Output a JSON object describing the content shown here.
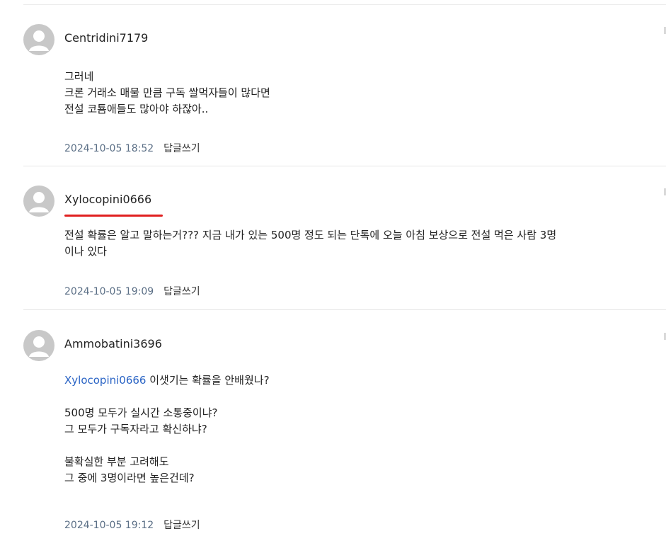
{
  "comments": [
    {
      "author": "Centridini7179",
      "lines": [
        "그러네",
        "크론 거래소 매물 만큼 구독 쌀먹자들이 많다면",
        "전설 코툠애들도 많아야 하잖아.."
      ],
      "date": "2024-10-05 18:52",
      "reply_label": "답글쓰기"
    },
    {
      "author": "Xylocopini0666",
      "lines": [
        "전설 확률은 알고 말하는거??? 지금 내가 있는 500명 정도 되는 단톡에 오늘 아침 보상으로 전설 먹은 사람 3명",
        "이나 있다"
      ],
      "date": "2024-10-05 19:09",
      "reply_label": "답글쓰기"
    },
    {
      "author": "Ammobatini3696",
      "mention": "Xylocopini0666",
      "mention_rest": " 이샛기는 확률을 안배웠나?",
      "lines_a": [
        "500명 모두가 실시간 소통중이냐?",
        "그 모두가 구독자라고 확신하냐?"
      ],
      "lines_b": [
        "불확실한 부분 고려해도",
        "그 중에 3명이라면 높은건데?"
      ],
      "date": "2024-10-05 19:12",
      "reply_label": "답글쓰기"
    }
  ]
}
